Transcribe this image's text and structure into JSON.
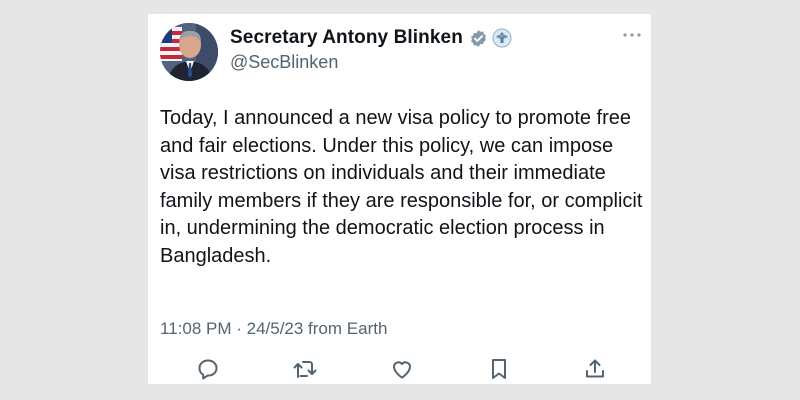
{
  "tweet": {
    "display_name": "Secretary Antony Blinken",
    "handle": "@SecBlinken",
    "text": "Today, I announced a new visa policy to promote free and fair elections. Under this policy, we can impose visa restrictions on individuals and their immediate family members if they are responsible for, or complicit in, undermining the democratic election process in Bangladesh.",
    "timestamp": "11:08 PM · 24/5/23 from Earth"
  },
  "icons": {
    "avatar": "profile-photo",
    "verified": "verified-badge-icon",
    "affiliation": "government-seal-icon",
    "more": "more-options-icon",
    "reply": "reply-icon",
    "retweet": "retweet-icon",
    "like": "heart-icon",
    "bookmark": "bookmark-icon",
    "share": "share-icon"
  },
  "colors": {
    "primary_text": "#0f1419",
    "secondary_text": "#536471",
    "verified_badge": "#829aab",
    "background": "#e6e6e6",
    "card": "#ffffff"
  }
}
